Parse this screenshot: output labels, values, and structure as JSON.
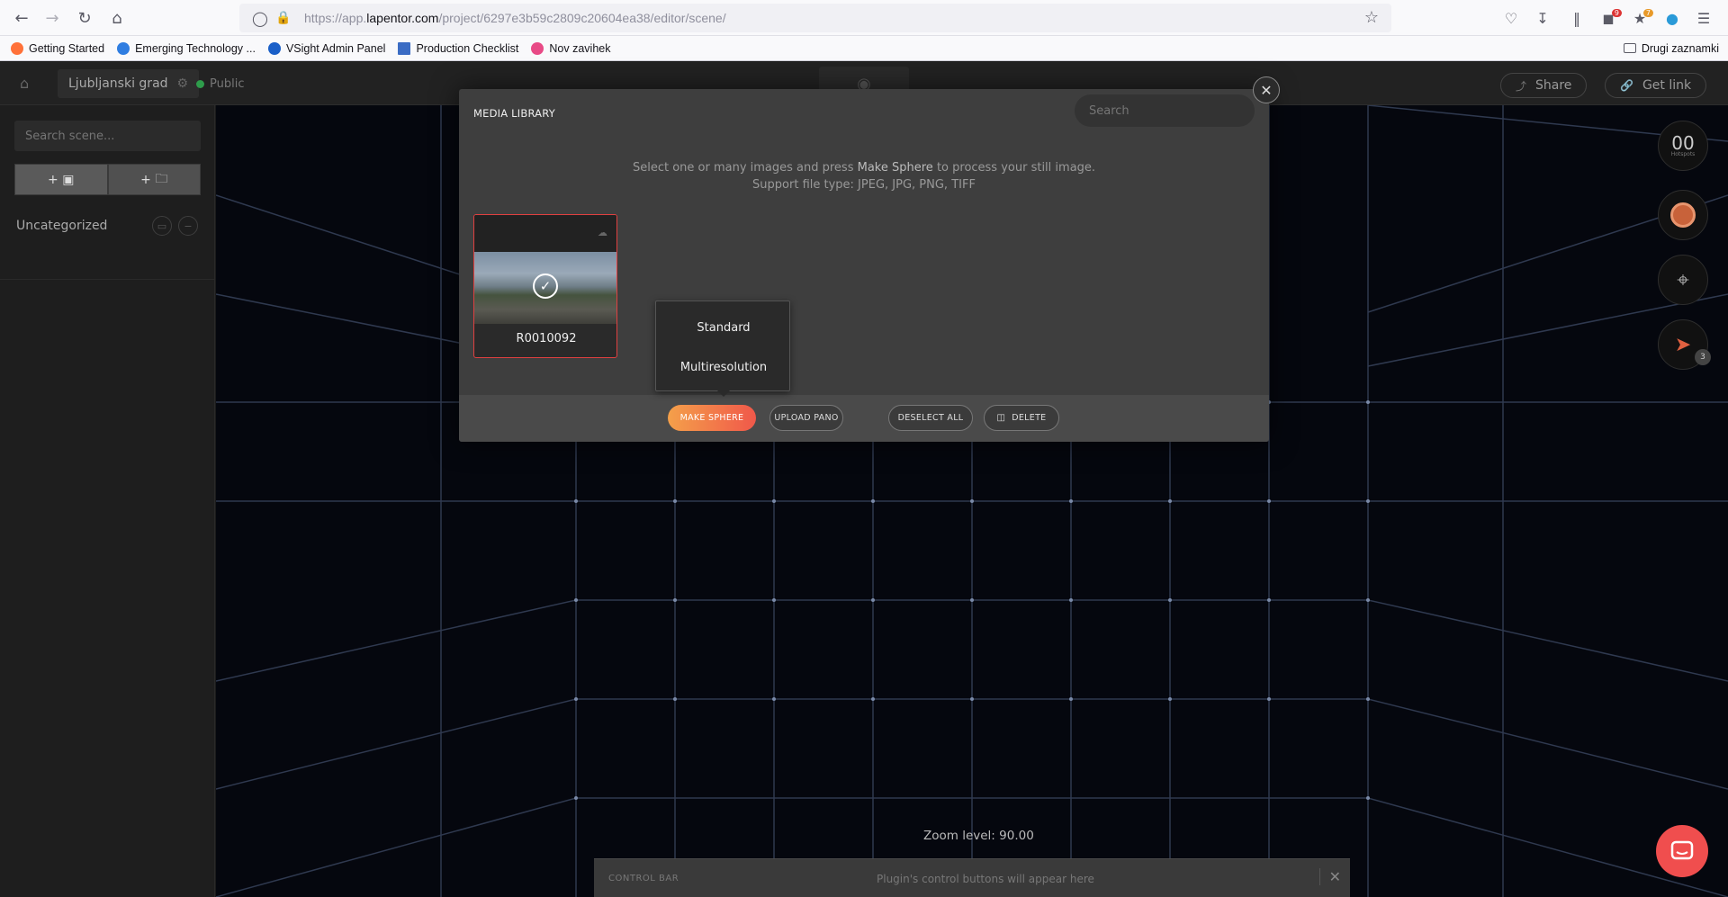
{
  "browser": {
    "url_prefix": "https://app.",
    "url_domain": "lapentor.com",
    "url_path": "/project/6297e3b59c2809c20604ea38/editor/scene/",
    "badge_1": "9",
    "badge_2": "7",
    "bookmarks": [
      {
        "label": "Getting Started",
        "color": "#ff7139"
      },
      {
        "label": "Emerging Technology ...",
        "color": "#2f7de1"
      },
      {
        "label": "VSight Admin Panel",
        "color": "#1a5fc8"
      },
      {
        "label": "Production Checklist",
        "color": "#3b6cc4"
      },
      {
        "label": "Nov zavihek",
        "color": "#e84a86"
      }
    ],
    "other_bookmarks": "Drugi zaznamki"
  },
  "header": {
    "project_name": "Ljubljanski grad",
    "visibility": "Public",
    "share_label": "Share",
    "get_link_label": "Get link"
  },
  "sidebar": {
    "search_placeholder": "Search scene...",
    "add_image_label": "+",
    "add_folder_label": "+",
    "group_name": "Uncategorized"
  },
  "viewer": {
    "zoom_text": "Zoom level: 90.00",
    "control_bar_label": "CONTROL BAR",
    "control_bar_message": "Plugin's control buttons will appear here"
  },
  "rail": {
    "hotspot_count": "00",
    "hotspot_label": "Hotspots",
    "publish_badge": "3"
  },
  "modal": {
    "title": "MEDIA LIBRARY",
    "search_placeholder": "Search",
    "info_prefix": "Select one or many images and press ",
    "info_highlight": "Make Sphere",
    "info_suffix": " to process your still image.",
    "info_line2": "Support file type: JPEG, JPG, PNG, TIFF",
    "media_items": [
      {
        "name": "R0010092",
        "selected": true
      }
    ],
    "popover_options": [
      "Standard",
      "Multiresolution"
    ],
    "buttons": {
      "make_sphere": "MAKE SPHERE",
      "upload_pano": "UPLOAD PANO",
      "deselect_all": "DESELECT ALL",
      "delete": "DELETE"
    }
  },
  "colors": {
    "accent_gradient_start": "#f4a04a",
    "accent_gradient_end": "#f0584a",
    "selection_border": "#e04040",
    "public_dot": "#2e9c4b",
    "chat_button": "#f04e4e"
  }
}
